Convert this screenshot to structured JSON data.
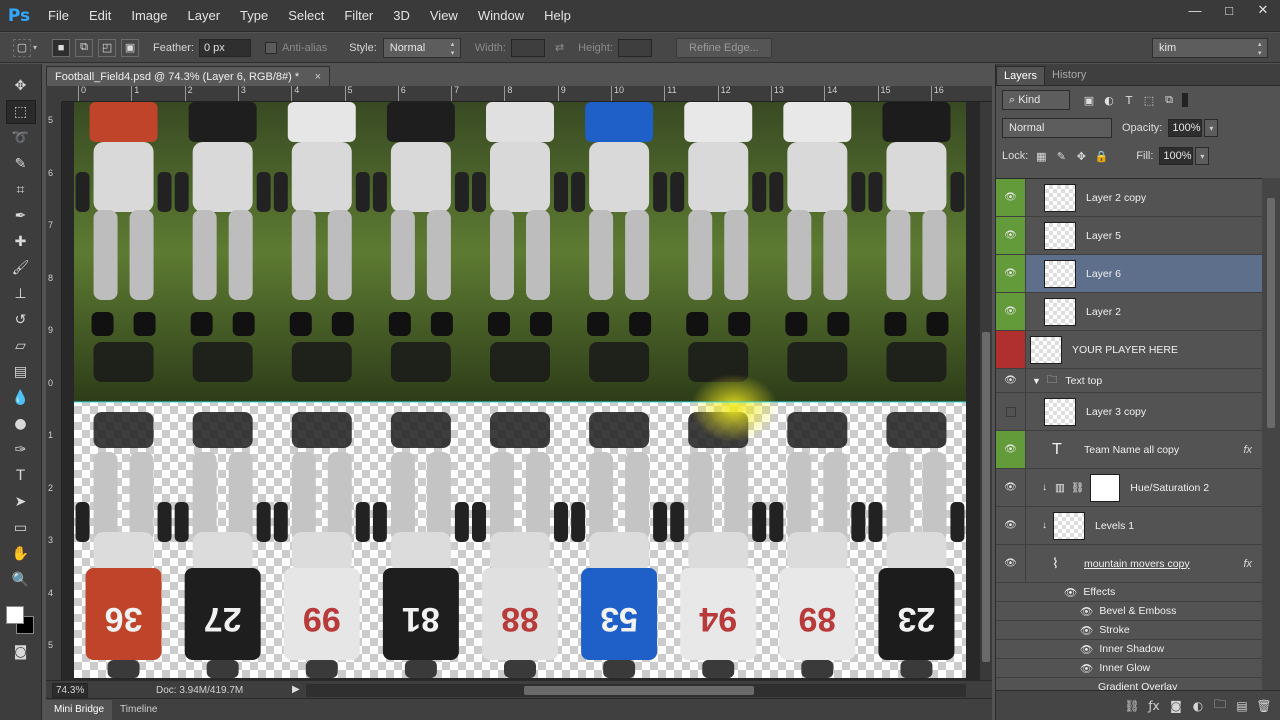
{
  "app": {
    "logo": "Ps"
  },
  "menu": [
    "File",
    "Edit",
    "Image",
    "Layer",
    "Type",
    "Select",
    "Filter",
    "3D",
    "View",
    "Window",
    "Help"
  ],
  "window_controls": {
    "minimize": "—",
    "restore": "□",
    "close": "✕"
  },
  "options": {
    "feather_label": "Feather:",
    "feather_value": "0 px",
    "antialias_label": "Anti-alias",
    "style_label": "Style:",
    "style_value": "Normal",
    "width_label": "Width:",
    "height_label": "Height:",
    "refine_edge": "Refine Edge...",
    "workspace": "kim"
  },
  "document": {
    "tab_title": "Football_Field4.psd @ 74.3% (Layer 6, RGB/8#) *",
    "close": "×",
    "zoom": "74.3%",
    "doc_info": "Doc: 3.94M/419.7M",
    "ruler_top": [
      "0",
      "1",
      "2",
      "3",
      "4",
      "5",
      "6",
      "7",
      "8",
      "9",
      "10",
      "11",
      "12",
      "13",
      "14",
      "15",
      "16"
    ],
    "ruler_left": [
      "5",
      "6",
      "7",
      "8",
      "9",
      "0",
      "1",
      "2",
      "3",
      "4",
      "5",
      "6"
    ]
  },
  "bottom_tabs": [
    "Mini Bridge",
    "Timeline"
  ],
  "panels": {
    "tabs": [
      "Layers",
      "History"
    ],
    "filter_kind": "Kind",
    "blend_mode": "Normal",
    "opacity_label": "Opacity:",
    "opacity_value": "100%",
    "lock_label": "Lock:",
    "fill_label": "Fill:",
    "fill_value": "100%"
  },
  "layers": [
    {
      "name": "Layer 2 copy"
    },
    {
      "name": "Layer 5"
    },
    {
      "name": "Layer 6"
    },
    {
      "name": "Layer 2"
    },
    {
      "name": "YOUR PLAYER HERE"
    },
    {
      "name": "Text top"
    },
    {
      "name": "Layer 3 copy"
    },
    {
      "name": "Team Name all copy",
      "fx": "fx"
    },
    {
      "name": "Hue/Saturation 2"
    },
    {
      "name": "Levels 1"
    },
    {
      "name": "mountain movers copy",
      "fx": "fx"
    }
  ],
  "effects": {
    "title": "Effects",
    "items": [
      "Bevel & Emboss",
      "Stroke",
      "Inner Shadow",
      "Inner Glow",
      "Gradient Overlay"
    ]
  },
  "jerseys": [
    {
      "number": "36",
      "color": "#c0442a"
    },
    {
      "number": "27",
      "color": "#1e1e1e"
    },
    {
      "number": "99",
      "color": "#e6e6e6"
    },
    {
      "number": "81",
      "color": "#1e1e1e"
    },
    {
      "number": "88",
      "color": "#e0e0e0"
    },
    {
      "number": "53",
      "color": "#1e5fc8"
    },
    {
      "number": "94",
      "color": "#e8e8e8"
    },
    {
      "number": "89",
      "color": "#e8e8e8"
    },
    {
      "number": "23",
      "color": "#1c1c1c"
    }
  ],
  "colors": {
    "accent": "#31a8ff",
    "selected_layer": "#5e6f8c",
    "visible_green": "#639a3a",
    "hidden_red": "#b03030"
  }
}
